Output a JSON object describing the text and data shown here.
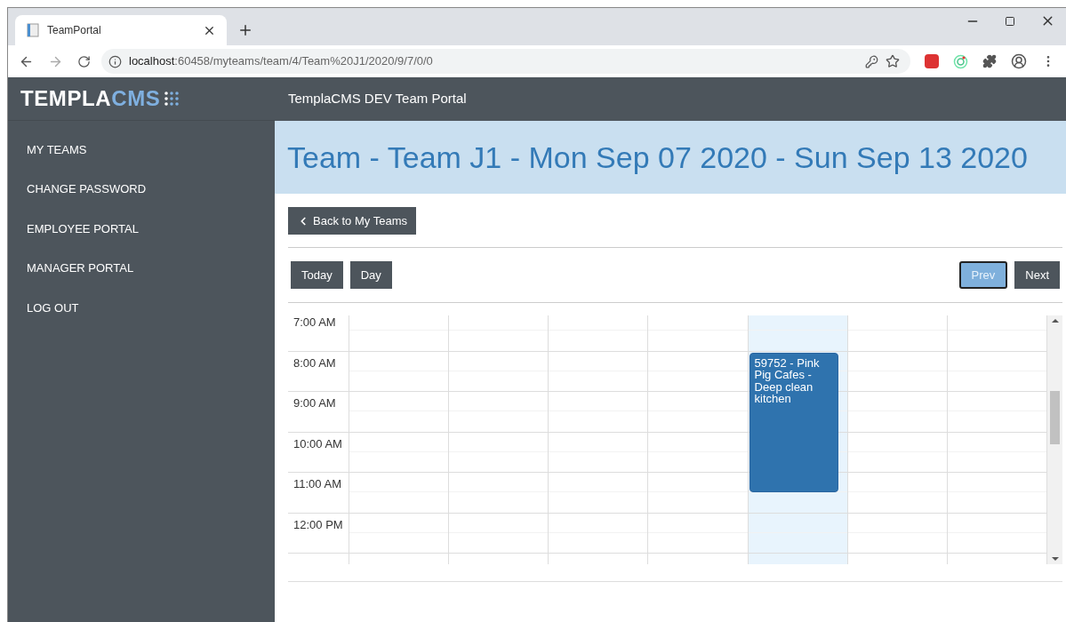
{
  "browser": {
    "tab": {
      "title": "TeamPortal"
    },
    "url_host": "localhost",
    "url_rest": ":60458/myteams/team/4/Team%20J1/2020/9/7/0/0"
  },
  "header": {
    "logo_main": "TEMPLA",
    "logo_accent": "CMS",
    "title": "TemplaCMS DEV Team Portal"
  },
  "sidebar": {
    "items": [
      {
        "label": "MY TEAMS"
      },
      {
        "label": "CHANGE PASSWORD"
      },
      {
        "label": "EMPLOYEE PORTAL"
      },
      {
        "label": "MANAGER PORTAL"
      },
      {
        "label": "LOG OUT"
      }
    ]
  },
  "page_title": "Team - Team J1 - Mon Sep 07 2020 - Sun Sep 13 2020",
  "back_button": "Back to My Teams",
  "toolbar": {
    "left": [
      {
        "label": "Today",
        "focused": false
      },
      {
        "label": "Day",
        "focused": false
      }
    ],
    "right": [
      {
        "label": "Prev",
        "focused": true
      },
      {
        "label": "Next",
        "focused": false
      }
    ]
  },
  "calendar": {
    "times": [
      "7:00 AM",
      "8:00 AM",
      "9:00 AM",
      "10:00 AM",
      "11:00 AM",
      "12:00 PM"
    ],
    "days": [
      {
        "today": false
      },
      {
        "today": false
      },
      {
        "today": false
      },
      {
        "today": false
      },
      {
        "today": true,
        "events": [
          {
            "text": "59752 - Pink Pig Cafes - Deep clean kitchen"
          }
        ]
      },
      {
        "today": false
      },
      {
        "today": false
      }
    ]
  }
}
